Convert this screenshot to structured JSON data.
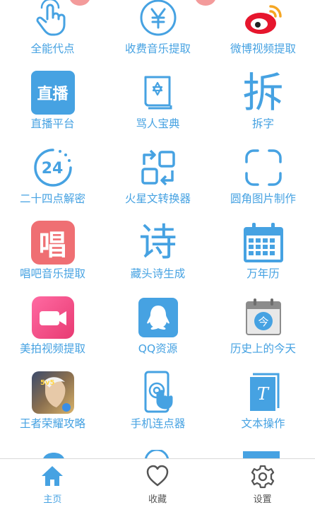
{
  "grid": {
    "items": [
      {
        "label": "全能代点",
        "icon": "tap-hand-icon"
      },
      {
        "label": "收费音乐提取",
        "icon": "yen-coin-icon"
      },
      {
        "label": "微博视频提取",
        "icon": "weibo-icon"
      },
      {
        "label": "直播平台",
        "icon": "live-broadcast-icon",
        "icon_text": "直播"
      },
      {
        "label": "骂人宝典",
        "icon": "book-star-icon"
      },
      {
        "label": "拆字",
        "icon": "chai-char-icon",
        "icon_text": "拆"
      },
      {
        "label": "二十四点解密",
        "icon": "24-clock-icon",
        "icon_text": "24"
      },
      {
        "label": "火星文转换器",
        "icon": "convert-arrows-icon"
      },
      {
        "label": "圆角图片制作",
        "icon": "rounded-corner-frame-icon"
      },
      {
        "label": "唱吧音乐提取",
        "icon": "changba-icon",
        "icon_text": "唱"
      },
      {
        "label": "藏头诗生成",
        "icon": "poem-char-icon",
        "icon_text": "诗"
      },
      {
        "label": "万年历",
        "icon": "calendar-icon"
      },
      {
        "label": "美拍视频提取",
        "icon": "meipai-video-icon"
      },
      {
        "label": "QQ资源",
        "icon": "qq-penguin-icon"
      },
      {
        "label": "历史上的今天",
        "icon": "today-calendar-icon",
        "icon_text": "今"
      },
      {
        "label": "王者荣耀攻略",
        "icon": "game-hero-icon",
        "icon_text": "5v5"
      },
      {
        "label": "手机连点器",
        "icon": "phone-tap-icon"
      },
      {
        "label": "文本操作",
        "icon": "text-document-icon",
        "icon_text": "T"
      }
    ]
  },
  "tabbar": {
    "tabs": [
      {
        "label": "主页",
        "icon": "home-icon"
      },
      {
        "label": "收藏",
        "icon": "heart-icon"
      },
      {
        "label": "设置",
        "icon": "gear-icon"
      }
    ]
  },
  "colors": {
    "accent": "#46a2e2",
    "pink": "#f18a8a",
    "weibo_red": "#e6162d"
  }
}
